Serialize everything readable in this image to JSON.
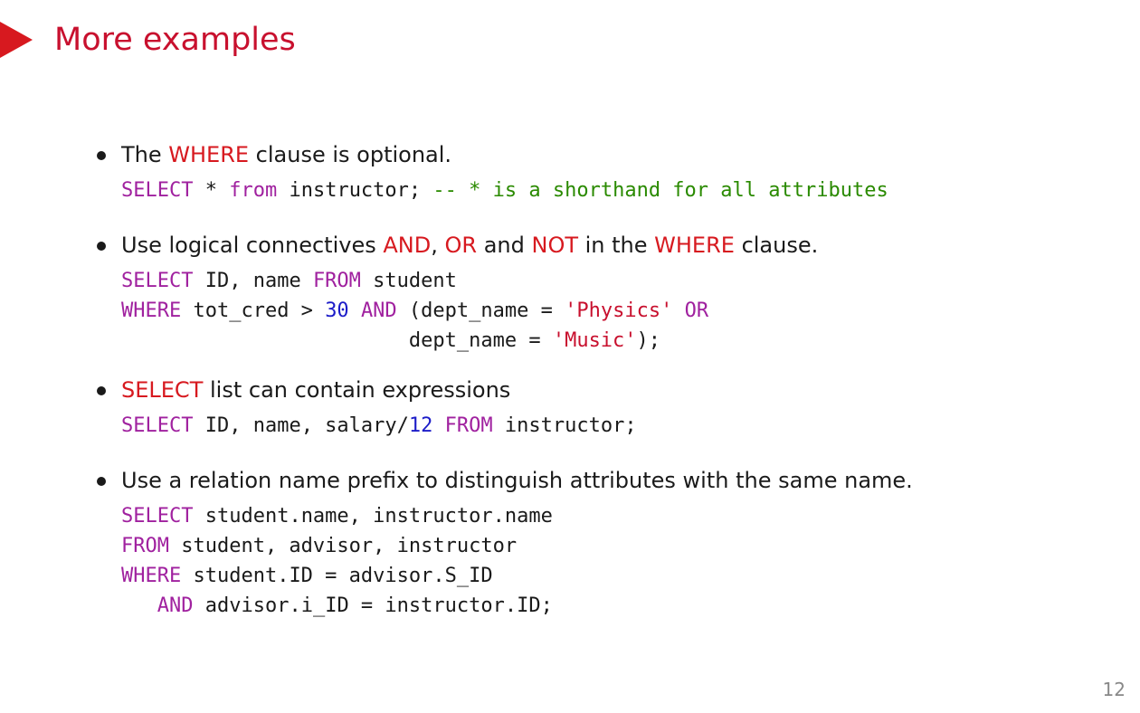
{
  "slide": {
    "title": "More examples",
    "page_number": "12",
    "accent_color": "#d7191f"
  },
  "bullets": [
    {
      "text": [
        "The ",
        "WHERE",
        " clause is optional."
      ],
      "code": [
        [
          [
            "kw",
            "SELECT"
          ],
          [
            "p",
            " * "
          ],
          [
            "kw",
            "from"
          ],
          [
            "p",
            " instructor; "
          ],
          [
            "cmt",
            "-- * is a shorthand for all attributes"
          ]
        ]
      ]
    },
    {
      "text": [
        "Use logical connectives ",
        "AND",
        ", ",
        "OR",
        " and ",
        "NOT",
        " in the ",
        "WHERE",
        " clause."
      ],
      "code": [
        [
          [
            "kw",
            "SELECT"
          ],
          [
            "p",
            " ID, name "
          ],
          [
            "kw",
            "FROM"
          ],
          [
            "p",
            " student"
          ]
        ],
        [
          [
            "kw",
            "WHERE"
          ],
          [
            "p",
            " tot_cred > "
          ],
          [
            "num",
            "30"
          ],
          [
            "p",
            " "
          ],
          [
            "kw",
            "AND"
          ],
          [
            "p",
            " (dept_name = "
          ],
          [
            "str",
            "'Physics'"
          ],
          [
            "p",
            " "
          ],
          [
            "kw",
            "OR"
          ]
        ],
        [
          [
            "p",
            "                        dept_name = "
          ],
          [
            "str",
            "'Music'"
          ],
          [
            "p",
            ");"
          ]
        ]
      ]
    },
    {
      "text": [
        "SELECT",
        " list can contain expressions"
      ],
      "code": [
        [
          [
            "kw",
            "SELECT"
          ],
          [
            "p",
            " ID, name, salary/"
          ],
          [
            "num",
            "12"
          ],
          [
            "p",
            " "
          ],
          [
            "kw",
            "FROM"
          ],
          [
            "p",
            " instructor;"
          ]
        ]
      ]
    },
    {
      "text": [
        "Use a relation name prefix to distinguish attributes with the same name."
      ],
      "code": [
        [
          [
            "kw",
            "SELECT"
          ],
          [
            "p",
            " student.name, instructor.name"
          ]
        ],
        [
          [
            "kw",
            "FROM"
          ],
          [
            "p",
            " student, advisor, instructor"
          ]
        ],
        [
          [
            "kw",
            "WHERE"
          ],
          [
            "p",
            " student.ID = advisor.S_ID"
          ]
        ],
        [
          [
            "p",
            "   "
          ],
          [
            "kw",
            "AND"
          ],
          [
            "p",
            " advisor.i_ID = instructor.ID;"
          ]
        ]
      ]
    }
  ]
}
